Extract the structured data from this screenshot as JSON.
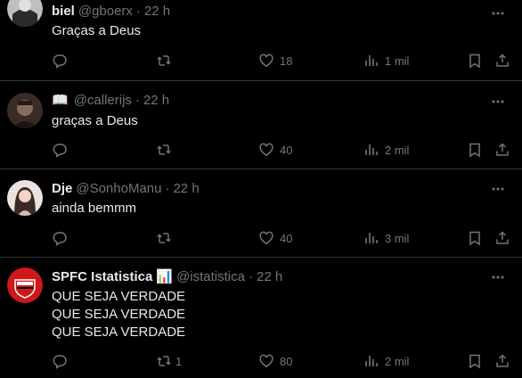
{
  "tweets": [
    {
      "name": "biel",
      "handle": "@gboerx",
      "dot": "·",
      "time": "22 h",
      "lines": [
        "Graças a Deus"
      ],
      "replies": "",
      "reposts": "",
      "likes": "18",
      "views": "1 mil",
      "avatar_colors": [
        "#c9c9c9",
        "#2b2b2b"
      ]
    },
    {
      "name_emoji": "📖",
      "handle": "@callerijs",
      "dot": "·",
      "time": "22 h",
      "lines": [
        "graças a Deus"
      ],
      "replies": "",
      "reposts": "",
      "likes": "40",
      "views": "2 mil",
      "avatar_colors": [
        "#6b4f45",
        "#2a1e1a"
      ]
    },
    {
      "name": "Dje",
      "handle": "@SonhoManu",
      "dot": "·",
      "time": "22 h",
      "lines": [
        "ainda bemmm"
      ],
      "replies": "",
      "reposts": "",
      "likes": "40",
      "views": "3 mil",
      "avatar_colors": [
        "#f0e6e2",
        "#3a2a28"
      ]
    },
    {
      "name": "SPFC Istatistica",
      "name_badge": "📊",
      "handle": "@istatistica",
      "dot": "·",
      "time": "22 h",
      "lines": [
        "QUE SEJA VERDADE",
        "QUE SEJA VERDADE",
        "QUE SEJA VERDADE"
      ],
      "replies": "",
      "reposts": "1",
      "likes": "80",
      "views": "2 mil",
      "avatar_colors": [
        "#d0171c",
        "#ffffff"
      ]
    }
  ],
  "colors": {
    "background": "#000000",
    "text": "#e7e9ea",
    "muted": "#71767b",
    "divider": "#2f3336"
  }
}
